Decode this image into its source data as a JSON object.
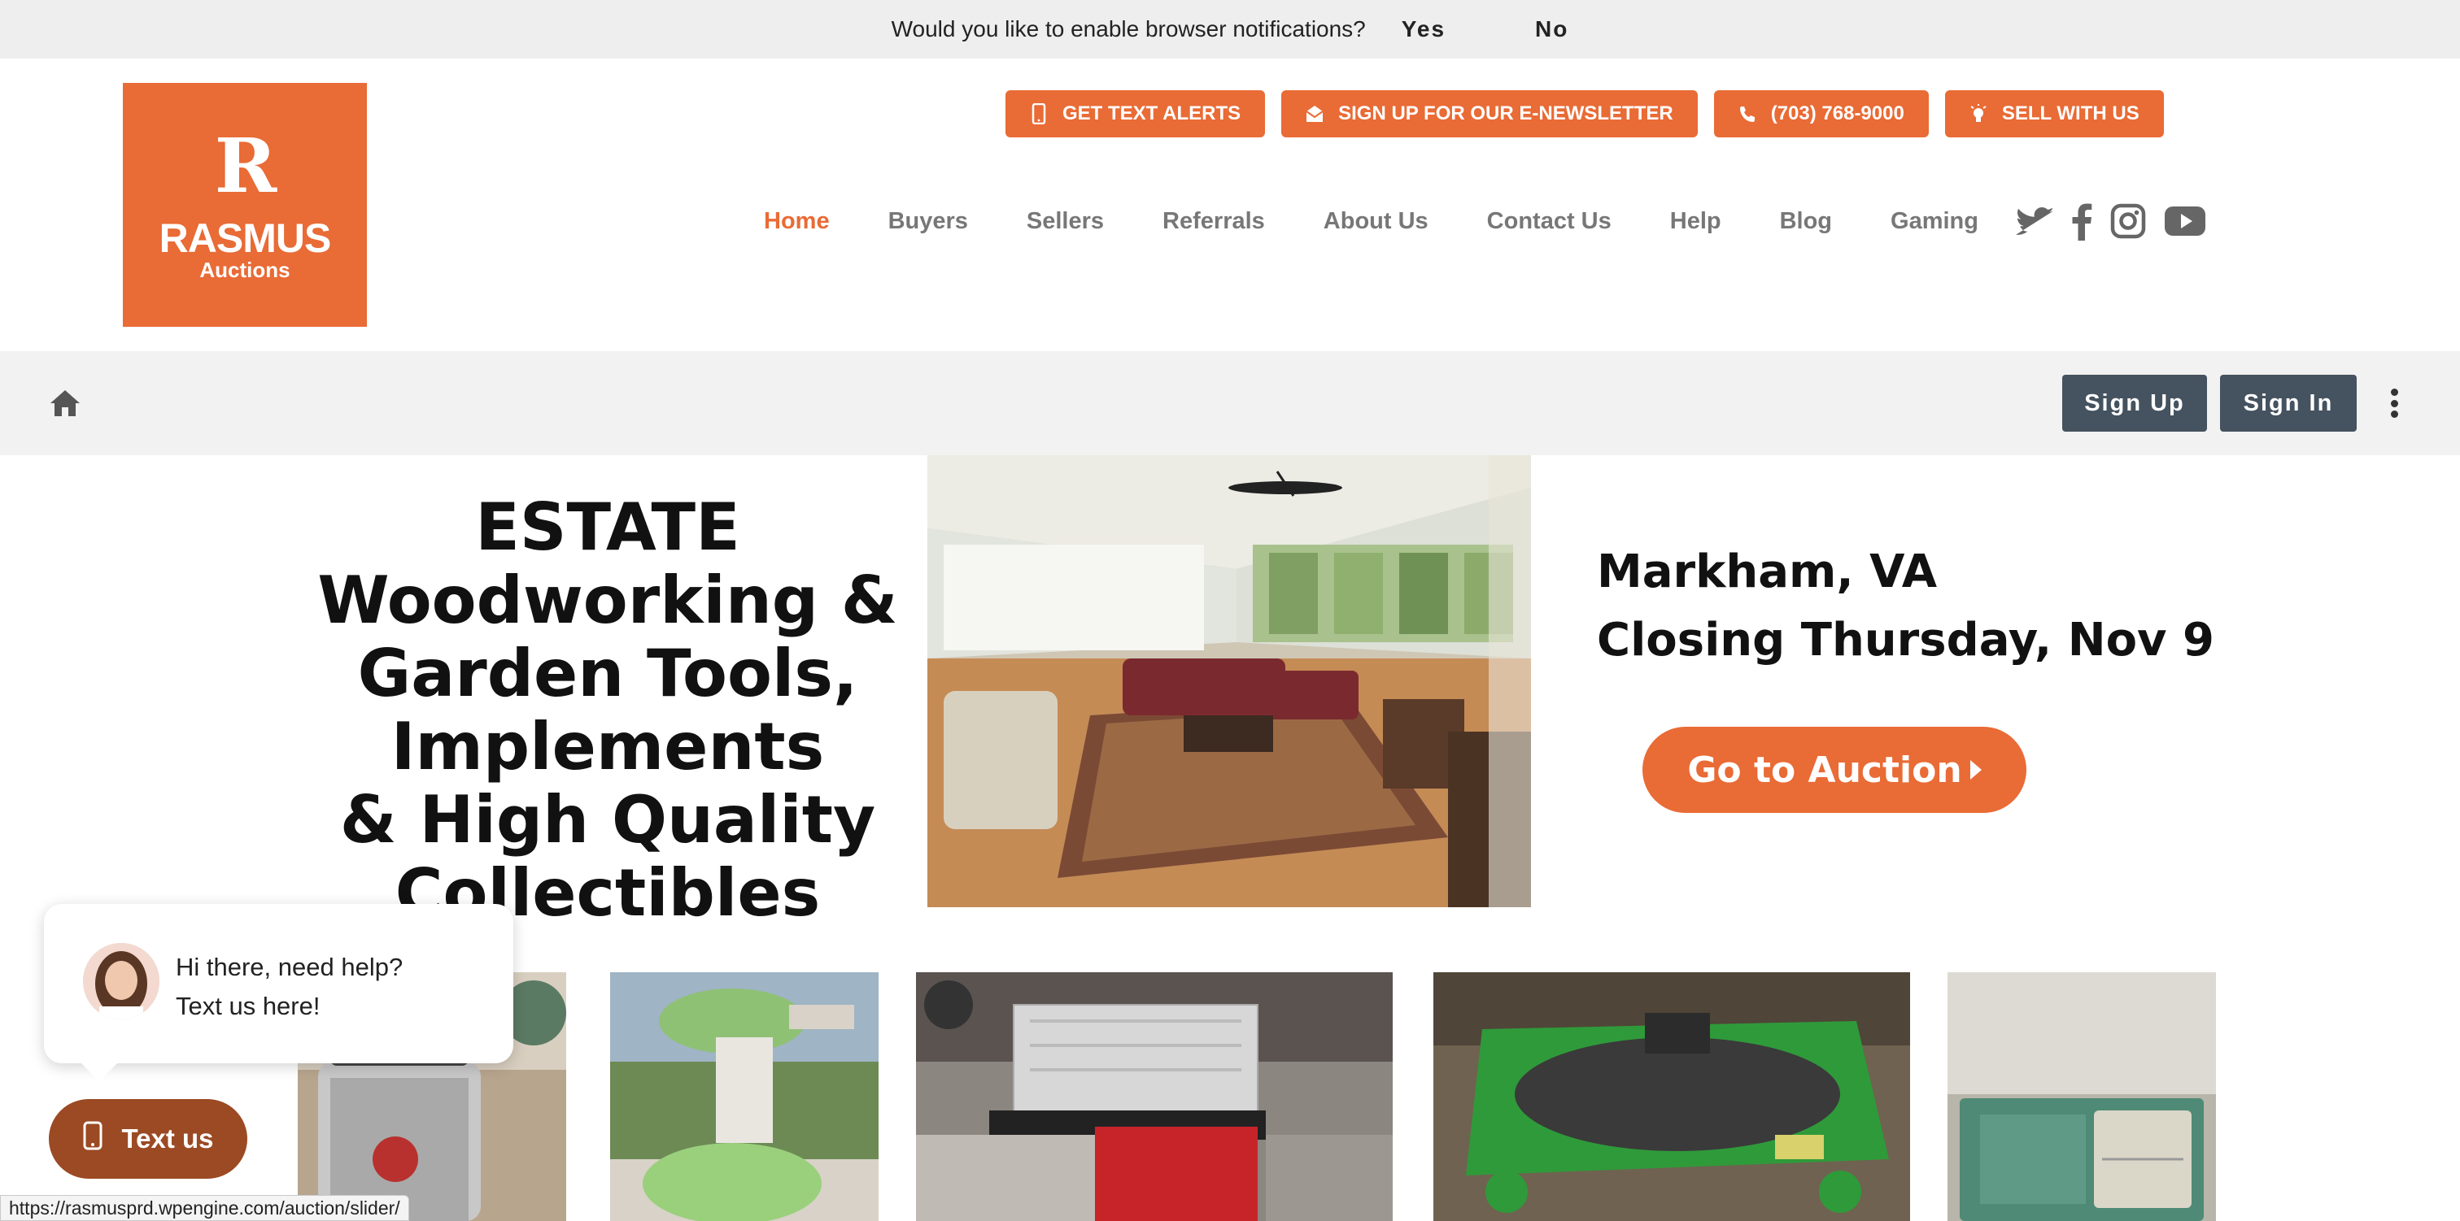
{
  "notification": {
    "text": "Would you like to enable browser notifications?",
    "yes": "Yes",
    "no": "No"
  },
  "logo": {
    "name": "RASMUS",
    "sub": "Auctions"
  },
  "top_buttons": [
    {
      "label": "GET TEXT ALERTS",
      "icon": "mobile-icon"
    },
    {
      "label": "SIGN UP FOR OUR E-NEWSLETTER",
      "icon": "envelope-icon"
    },
    {
      "label": "(703) 768-9000",
      "icon": "phone-icon"
    },
    {
      "label": "SELL WITH US",
      "icon": "lightbulb-icon"
    }
  ],
  "nav": [
    {
      "label": "Home",
      "active": true
    },
    {
      "label": "Buyers"
    },
    {
      "label": "Sellers"
    },
    {
      "label": "Referrals"
    },
    {
      "label": "About Us"
    },
    {
      "label": "Contact Us"
    },
    {
      "label": "Help"
    },
    {
      "label": "Blog"
    },
    {
      "label": "Gaming"
    }
  ],
  "social": [
    "twitter-icon",
    "facebook-icon",
    "instagram-icon",
    "youtube-icon"
  ],
  "account": {
    "sign_up": "Sign Up",
    "sign_in": "Sign In"
  },
  "hero": {
    "title_lines": [
      "ESTATE",
      "Woodworking &",
      "Garden Tools,",
      "Implements",
      "& High Quality",
      "Collectibles"
    ],
    "location": "Markham, VA",
    "closing": "Closing Thursday, Nov 9",
    "button": "Go to Auction"
  },
  "chat": {
    "line1": "Hi there, need help?",
    "line2": "Text us here!",
    "button": "Text us"
  },
  "status_url": "https://rasmusprd.wpengine.com/auction/slider/",
  "colors": {
    "brand_orange": "#e96b35",
    "account_button": "#45525f",
    "chat_button": "#9b4a23",
    "nav_gray": "#777777"
  }
}
